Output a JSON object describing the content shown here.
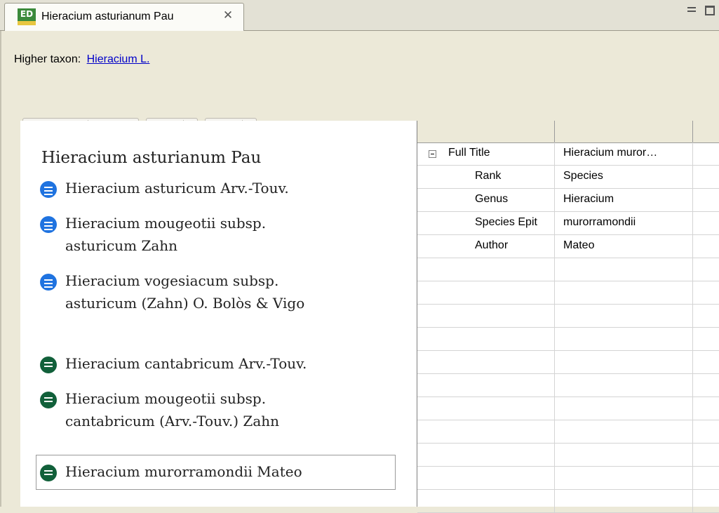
{
  "tab": {
    "title": "Hieracium asturianum Pau",
    "icon": "editor-icon",
    "icon_label": "ED"
  },
  "header": {
    "higher_taxon_label": "Higher taxon:",
    "higher_taxon_link": "Hieracium L."
  },
  "toolbar": {
    "buttons": [
      "save-icon",
      "refresh-icon",
      "delete-icon",
      "list-icon",
      "add-icon"
    ]
  },
  "names": {
    "accepted": "Hieracium asturianum Pau",
    "synonyms": [
      {
        "text": "Hieracium asturicum Arv.-Touv.",
        "type": "homotypic"
      },
      {
        "text": "Hieracium mougeotii subsp.\nasturicum Zahn",
        "type": "homotypic"
      },
      {
        "text": "Hieracium vogesiacum subsp.\nasturicum (Zahn) O. Bolòs & Vigo",
        "type": "homotypic"
      },
      {
        "text": "Hieracium cantabricum Arv.-Touv.",
        "type": "heterotypic"
      },
      {
        "text": "Hieracium mougeotii subsp.\ncantabricum (Arv.-Touv.) Zahn",
        "type": "heterotypic"
      },
      {
        "text": "Hieracium murorramondii Mateo",
        "type": "heterotypic",
        "selected": true
      }
    ]
  },
  "properties": {
    "rows": [
      {
        "key": "Full Title",
        "value": "Hieracium muror…"
      },
      {
        "key": "Rank",
        "value": "Species"
      },
      {
        "key": "Genus",
        "value": "Hieracium"
      },
      {
        "key": "Species Epit",
        "value": "murorramondii"
      },
      {
        "key": "Author",
        "value": "Mateo"
      }
    ]
  },
  "colors": {
    "homotypic_icon": "#1f73e0",
    "heterotypic_icon": "#11603a",
    "link": "#0000c8"
  }
}
